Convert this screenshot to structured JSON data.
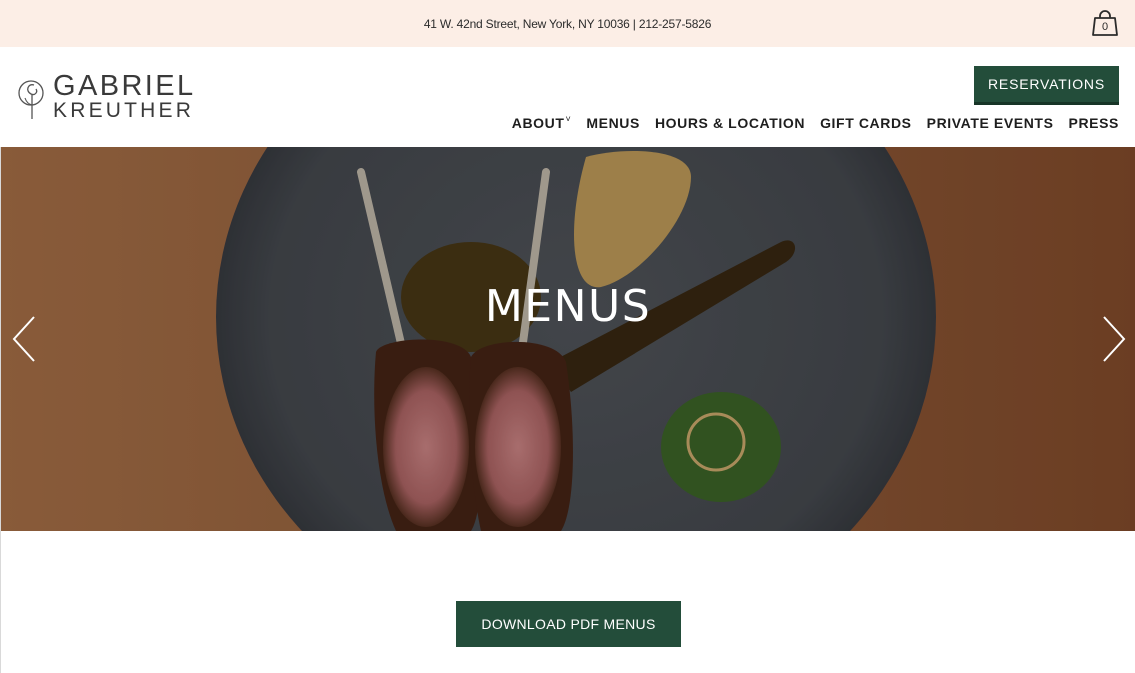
{
  "topbar": {
    "address": "41 W. 42nd Street, New York, NY 10036 | 212-257-5826",
    "cart_count": "0"
  },
  "logo": {
    "line1": "GABRIEL",
    "line2": "KREUTHER"
  },
  "header": {
    "reservations_label": "RESERVATIONS"
  },
  "nav": {
    "items": [
      {
        "label": "ABOUT",
        "has_dropdown": true
      },
      {
        "label": "MENUS"
      },
      {
        "label": "HOURS & LOCATION"
      },
      {
        "label": "GIFT CARDS"
      },
      {
        "label": "PRIVATE EVENTS"
      },
      {
        "label": "PRESS"
      }
    ]
  },
  "hero": {
    "title": "MENUS",
    "prev_icon": "chevron-left-icon",
    "next_icon": "chevron-right-icon"
  },
  "main": {
    "download_label": "DOWNLOAD PDF MENUS"
  },
  "colors": {
    "topbar_bg": "#fceee6",
    "brand_green": "#234d3a",
    "hero_overlay": "#000000"
  }
}
